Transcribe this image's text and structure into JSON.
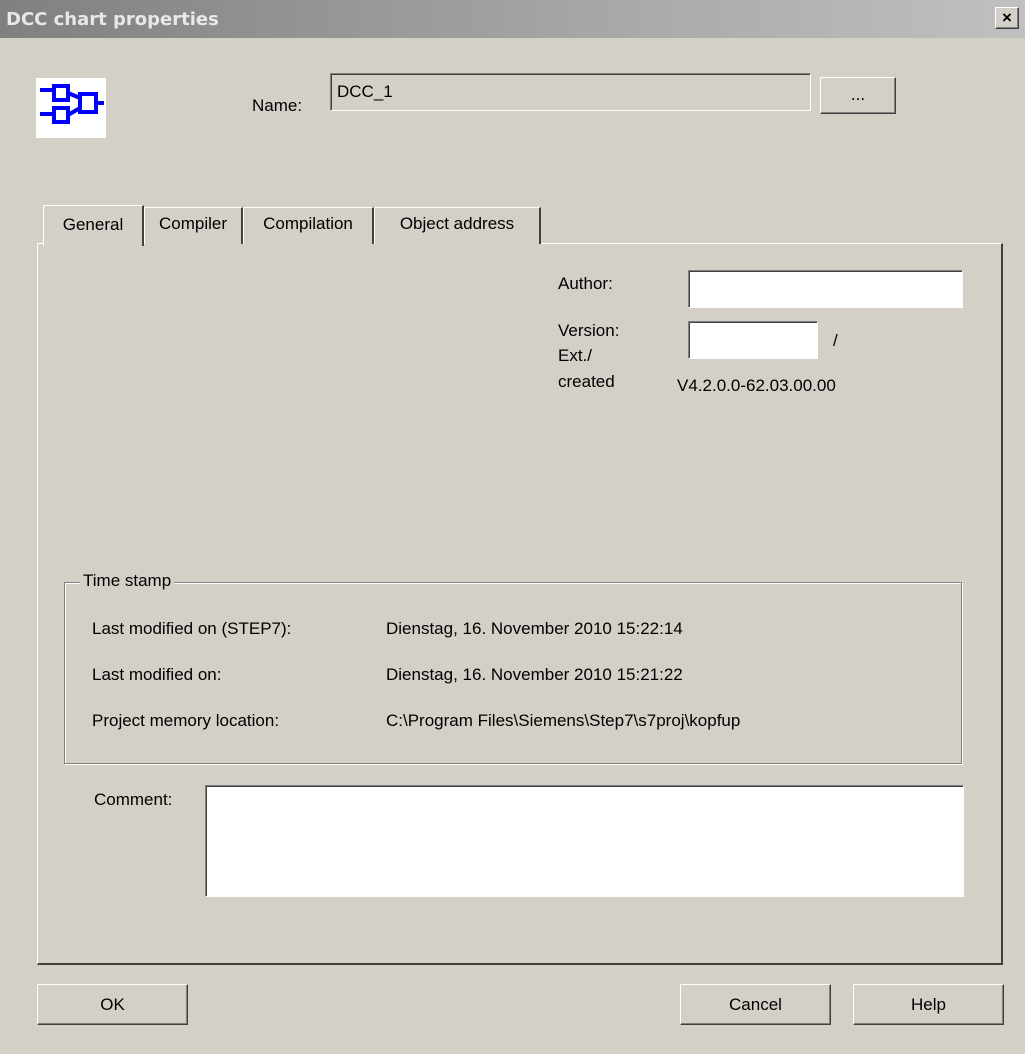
{
  "window": {
    "title": "DCC chart properties",
    "close_label": "×"
  },
  "header": {
    "icon": "dcc-chart-icon",
    "name_label": "Name:",
    "name_value": "DCC_1",
    "browse_label": "..."
  },
  "tabs": [
    {
      "label": "General",
      "active": true
    },
    {
      "label": "Compiler",
      "active": false
    },
    {
      "label": "Compilation",
      "active": false
    },
    {
      "label": "Object address",
      "active": false
    }
  ],
  "general": {
    "author_label": "Author:",
    "author_value": "",
    "version_label": "Version:",
    "version_value": "",
    "version_separator": "/",
    "ext_label": "Ext./",
    "created_label": "created",
    "created_value": "V4.2.0.0-62.03.00.00"
  },
  "timestamp": {
    "title": "Time stamp",
    "rows": [
      {
        "label": "Last modified on (STEP7):",
        "value": "Dienstag, 16. November 2010 15:22:14"
      },
      {
        "label": "Last modified on:",
        "value": "Dienstag, 16. November 2010 15:21:22"
      },
      {
        "label": "Project memory location:",
        "value": "C:\\Program Files\\Siemens\\Step7\\s7proj\\kopfup"
      }
    ]
  },
  "comment": {
    "label": "Comment:",
    "value": ""
  },
  "buttons": {
    "ok": "OK",
    "cancel": "Cancel",
    "help": "Help"
  },
  "colors": {
    "face": "#d4d0c8",
    "icon_blue": "#0000ff"
  }
}
